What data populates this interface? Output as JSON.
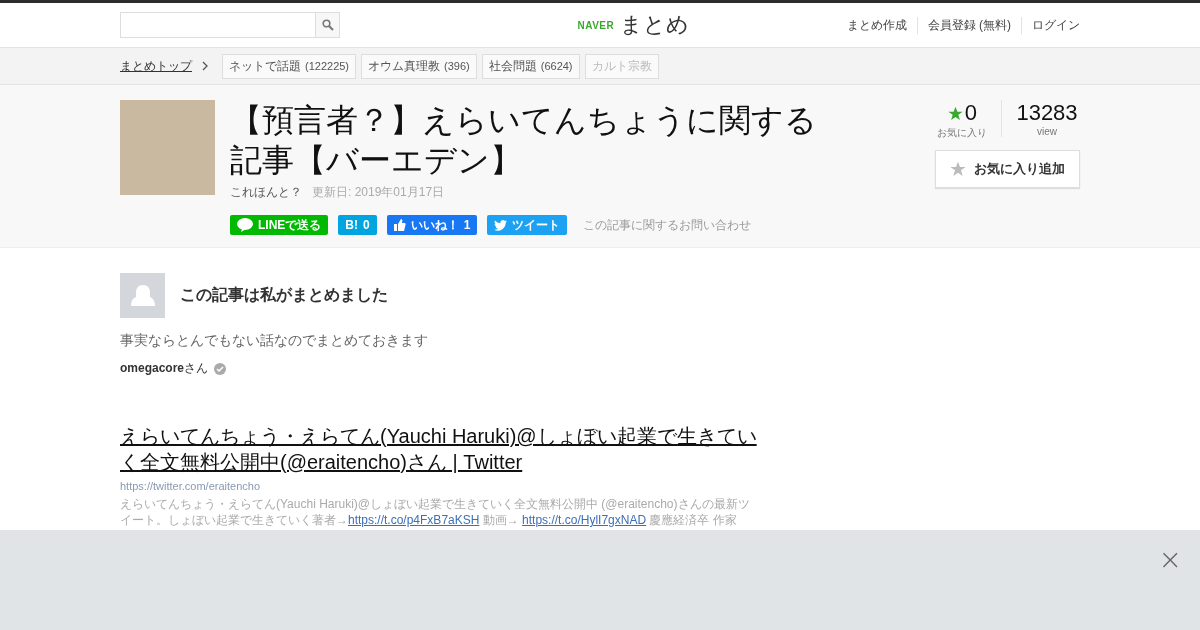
{
  "header": {
    "logo_brand": "NAVER",
    "logo_text": "まとめ",
    "nav": [
      "まとめ作成",
      "会員登録 (無料)",
      "ログイン"
    ]
  },
  "breadcrumb": {
    "top": "まとめトップ",
    "tags": [
      {
        "label": "ネットで話題",
        "count": "(122225)",
        "disabled": false
      },
      {
        "label": "オウム真理教",
        "count": "(396)",
        "disabled": false
      },
      {
        "label": "社会問題",
        "count": "(6624)",
        "disabled": false
      },
      {
        "label": "カルト宗教",
        "disabled": true
      }
    ]
  },
  "article": {
    "title": "【預言者？】えらいてんちょうに関する記事【バーエデン】",
    "author": "これほんと？",
    "updated": "更新日: 2019年01月17日",
    "share": [
      {
        "kind": "line",
        "label": "LINEで送る"
      },
      {
        "kind": "hatena",
        "label": "B!",
        "count": "0"
      },
      {
        "kind": "facebook",
        "label": "いいね！",
        "count": "1"
      },
      {
        "kind": "twitter",
        "label": "ツイート"
      }
    ],
    "contact": "この記事に関するお問い合わせ",
    "favorites": "0",
    "favorites_label": "お気に入り",
    "views": "13283",
    "views_label": "view",
    "favorite_button": "お気に入り追加"
  },
  "curator": {
    "heading": "この記事は私がまとめました",
    "description": "事実ならとんでもない話なのでまとめておきます",
    "name": "omegacore",
    "suffix": "さん"
  },
  "link_card": {
    "title": "えらいてんちょう・えらてん(Yauchi Haruki)@しょぼい起業で生きていく全文無料公開中(@eraitencho)さん | Twitter",
    "url": "https://twitter.com/eraitencho",
    "description": [
      {
        "kind": "text",
        "text": "えらいてんちょう・えらてん(Yauchi Haruki)@しょぼい起業で生きていく全文無料公開中 (@eraitencho)さんの最新ツイート。しょぼい起業で生きていく著者→"
      },
      {
        "kind": "link",
        "text": "https://t.co/p4FxB7aKSH"
      },
      {
        "kind": "text",
        "text": " 動画→ "
      },
      {
        "kind": "link",
        "text": "https://t.co/HylI7gxNAD"
      },
      {
        "kind": "text",
        "text": " 慶應経済卒 作家"
      }
    ]
  },
  "overlay": {
    "close": "×"
  }
}
